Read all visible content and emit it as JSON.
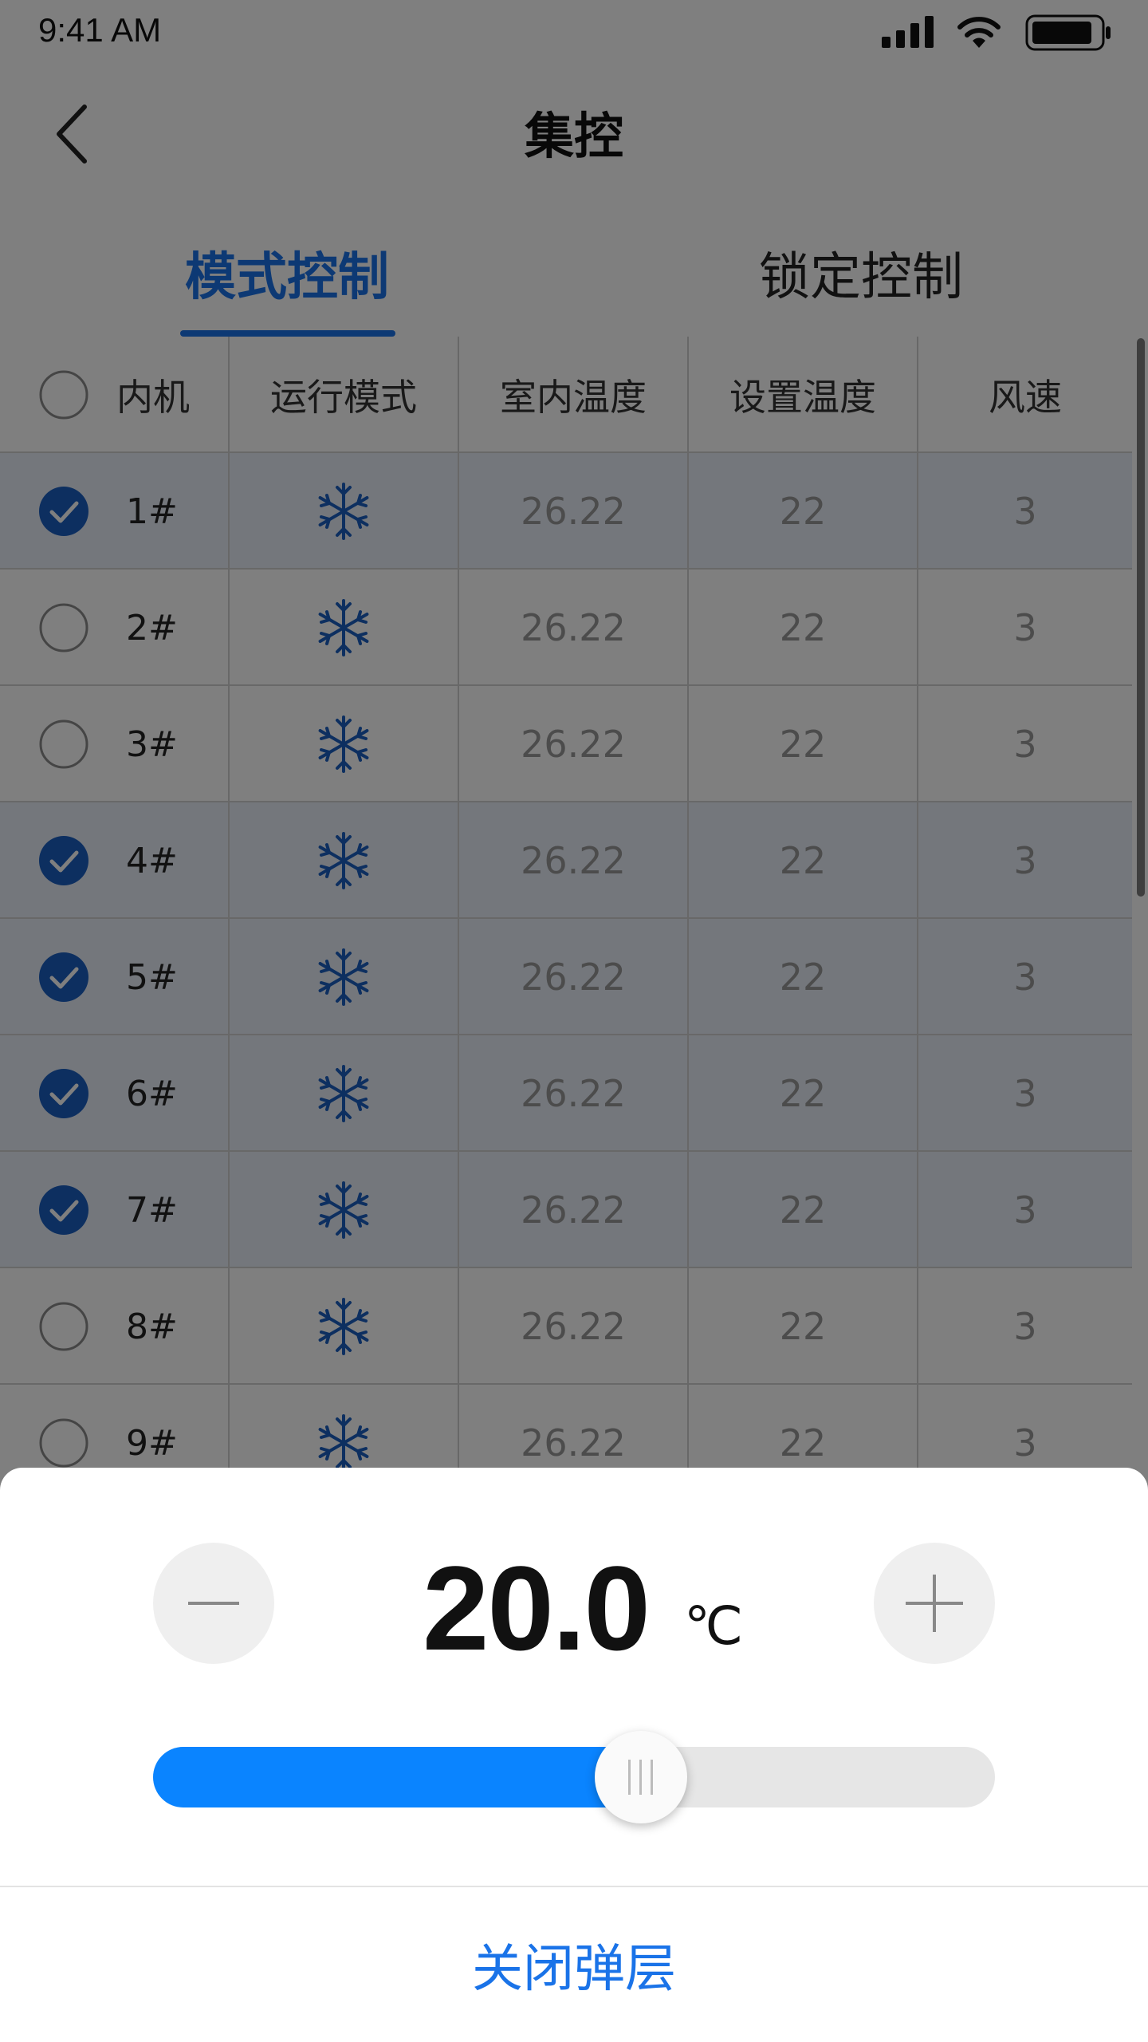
{
  "status_bar": {
    "time": "9:41 AM"
  },
  "nav": {
    "title": "集控"
  },
  "tabs": [
    {
      "label": "模式控制",
      "active": true
    },
    {
      "label": "锁定控制",
      "active": false
    }
  ],
  "table": {
    "headers": [
      "内机",
      "运行模式",
      "室内温度",
      "设置温度",
      "风速"
    ],
    "rows": [
      {
        "unit": "1#",
        "mode": "snowflake-icon",
        "indoor_temp": "26.22",
        "set_temp": "22",
        "fan_speed": "3",
        "checked": true
      },
      {
        "unit": "2#",
        "mode": "snowflake-icon",
        "indoor_temp": "26.22",
        "set_temp": "22",
        "fan_speed": "3",
        "checked": false
      },
      {
        "unit": "3#",
        "mode": "snowflake-icon",
        "indoor_temp": "26.22",
        "set_temp": "22",
        "fan_speed": "3",
        "checked": false
      },
      {
        "unit": "4#",
        "mode": "snowflake-icon",
        "indoor_temp": "26.22",
        "set_temp": "22",
        "fan_speed": "3",
        "checked": true
      },
      {
        "unit": "5#",
        "mode": "snowflake-icon",
        "indoor_temp": "26.22",
        "set_temp": "22",
        "fan_speed": "3",
        "checked": true
      },
      {
        "unit": "6#",
        "mode": "snowflake-icon",
        "indoor_temp": "26.22",
        "set_temp": "22",
        "fan_speed": "3",
        "checked": true
      },
      {
        "unit": "7#",
        "mode": "snowflake-icon",
        "indoor_temp": "26.22",
        "set_temp": "22",
        "fan_speed": "3",
        "checked": true
      },
      {
        "unit": "8#",
        "mode": "snowflake-icon",
        "indoor_temp": "26.22",
        "set_temp": "22",
        "fan_speed": "3",
        "checked": false
      },
      {
        "unit": "9#",
        "mode": "snowflake-icon",
        "indoor_temp": "26.22",
        "set_temp": "22",
        "fan_speed": "3",
        "checked": false
      }
    ]
  },
  "sheet": {
    "temperature": "20.0",
    "unit": "℃",
    "slider_fraction": 0.58,
    "close_label": "关闭弹层"
  },
  "colors": {
    "accent": "#1a73e8",
    "slider_fill": "#0a84ff",
    "selected_row": "#e8eef8"
  }
}
